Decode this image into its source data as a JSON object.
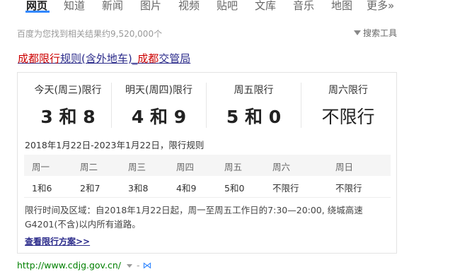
{
  "nav": {
    "items": [
      "网页",
      "知道",
      "新闻",
      "图片",
      "视频",
      "贴吧",
      "文库",
      "音乐",
      "地图",
      "更多»"
    ],
    "active": "网页"
  },
  "stats": "百度为您找到相关结果约9,520,000个",
  "tools_label": "搜索工具",
  "result": {
    "title_parts": [
      {
        "text": "成都限行",
        "hl": true
      },
      {
        "text": "规则(含外地车)_",
        "hl": false
      },
      {
        "text": "成都",
        "hl": true
      },
      {
        "text": "交管局",
        "hl": false
      }
    ],
    "days": [
      {
        "label": "今天(周三)限行",
        "value": "3 和 8",
        "bold": true
      },
      {
        "label": "明天(周四)限行",
        "value": "4 和 9",
        "bold": true
      },
      {
        "label": "周五限行",
        "value": "5 和 0",
        "bold": true
      },
      {
        "label": "周六限行",
        "value": "不限行",
        "bold": false
      }
    ],
    "rule_period": "2018年1月22日-2023年1月22日，限行规则",
    "table": {
      "headers": [
        "周一",
        "周二",
        "周三",
        "周四",
        "周五",
        "周六",
        "周日"
      ],
      "values": [
        "1和6",
        "2和7",
        "3和8",
        "4和9",
        "5和0",
        "不限行",
        "不限行"
      ]
    },
    "description": "限行时间及区域：自2018年1月22日起，周一至周五工作日的7:30—20:00, 绕城高速G4201(不含)以内所有道路。",
    "scheme_link": "查看限行方案>>",
    "url": "http://www.cdjg.gov.cn/",
    "url_dash": "-"
  }
}
